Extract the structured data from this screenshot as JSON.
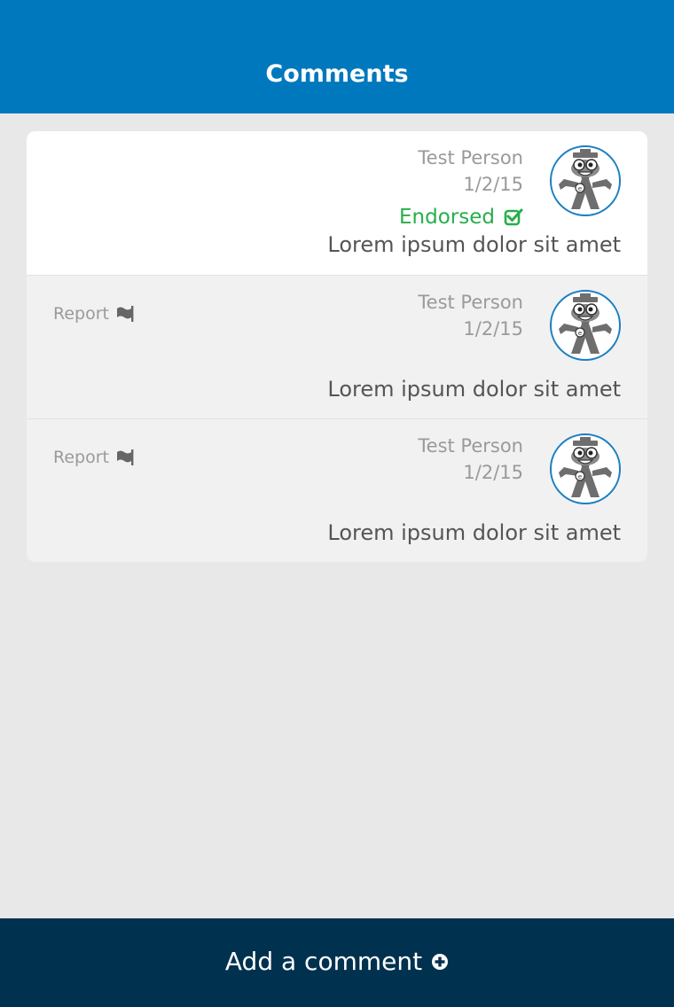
{
  "header": {
    "title": "Comments"
  },
  "comments": [
    {
      "author": "Test Person",
      "date": "1/2/15",
      "endorsed_label": "Endorsed",
      "text": "Lorem ipsum dolor sit amet"
    },
    {
      "author": "Test Person",
      "date": "1/2/15",
      "report_label": "Report",
      "text": "Lorem ipsum dolor sit amet"
    },
    {
      "author": "Test Person",
      "date": "1/2/15",
      "report_label": "Report",
      "text": "Lorem ipsum dolor sit amet"
    }
  ],
  "footer": {
    "add_label": "Add a comment"
  },
  "icons": {
    "endorsed": "check-square-icon",
    "report": "flag-icon",
    "add": "plus-circle-icon",
    "avatar": "robot-mascot-avatar"
  },
  "colors": {
    "header": "#0078be",
    "footer": "#00314f",
    "endorsed": "#27ae4a",
    "avatar_border": "#1a7fc3"
  }
}
